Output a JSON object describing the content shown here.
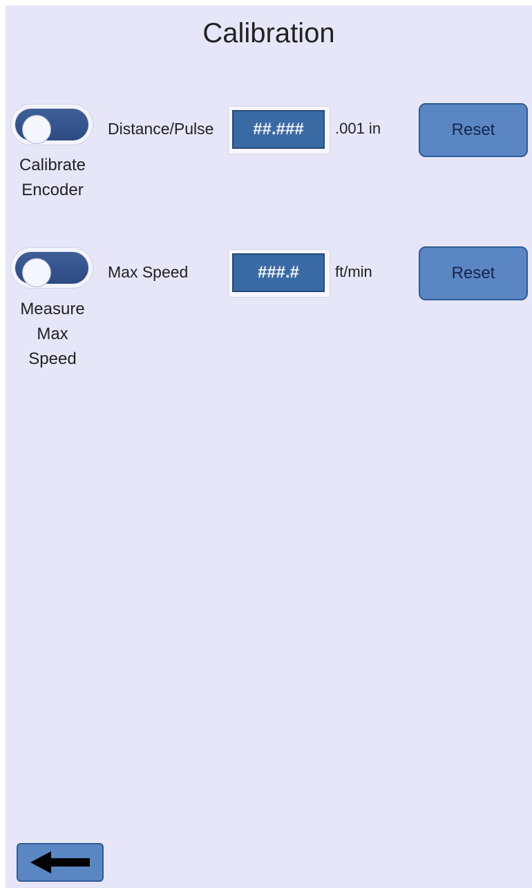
{
  "header": {
    "title": "Calibration"
  },
  "encoder": {
    "toggle_on": false,
    "caption": "Calibrate\nEncoder",
    "field_label": "Distance/Pulse",
    "value": "##.###",
    "unit": ".001 in",
    "reset_label": "Reset"
  },
  "max_speed": {
    "toggle_on": false,
    "caption": "Measure\nMax\nSpeed",
    "field_label": "Max Speed",
    "value": "###.#",
    "unit": "ft/min",
    "reset_label": "Reset"
  },
  "footer": {
    "back_icon": "left-arrow-icon"
  },
  "colors": {
    "background": "#e6e6f8",
    "accent": "#5b86c4",
    "field": "#3a6aa4",
    "toggle_track": "#2d4a82"
  }
}
